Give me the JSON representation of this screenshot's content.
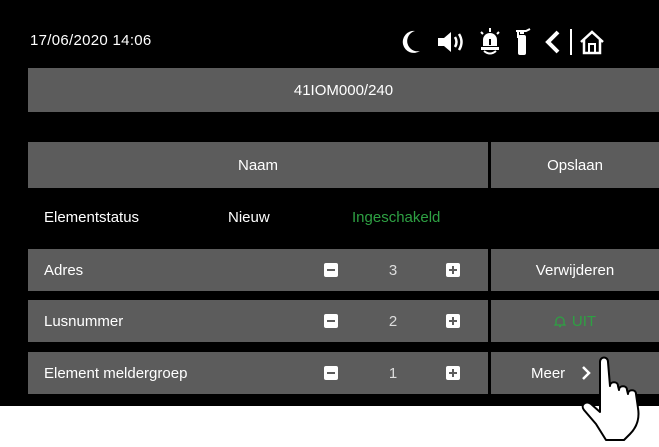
{
  "header": {
    "datetime": "17/06/2020  14:06",
    "icons": [
      "moon-icon",
      "speaker-icon",
      "siren-icon",
      "extinguisher-icon",
      "back-icon",
      "home-icon"
    ]
  },
  "title": "41IOM000/240",
  "name_button": "Naam",
  "save_button": "Opslaan",
  "status": {
    "label": "Elementstatus",
    "value": "Nieuw",
    "state": "Ingeschakeld"
  },
  "rows": [
    {
      "label": "Adres",
      "value": "3"
    },
    {
      "label": "Lusnummer",
      "value": "2"
    },
    {
      "label": "Element meldergroep",
      "value": "1"
    }
  ],
  "side_buttons": {
    "delete": "Verwijderen",
    "uit": "UIT",
    "more": "Meer"
  },
  "colors": {
    "background": "#000000",
    "panel": "#5c5c5c",
    "green": "#2ea043"
  }
}
